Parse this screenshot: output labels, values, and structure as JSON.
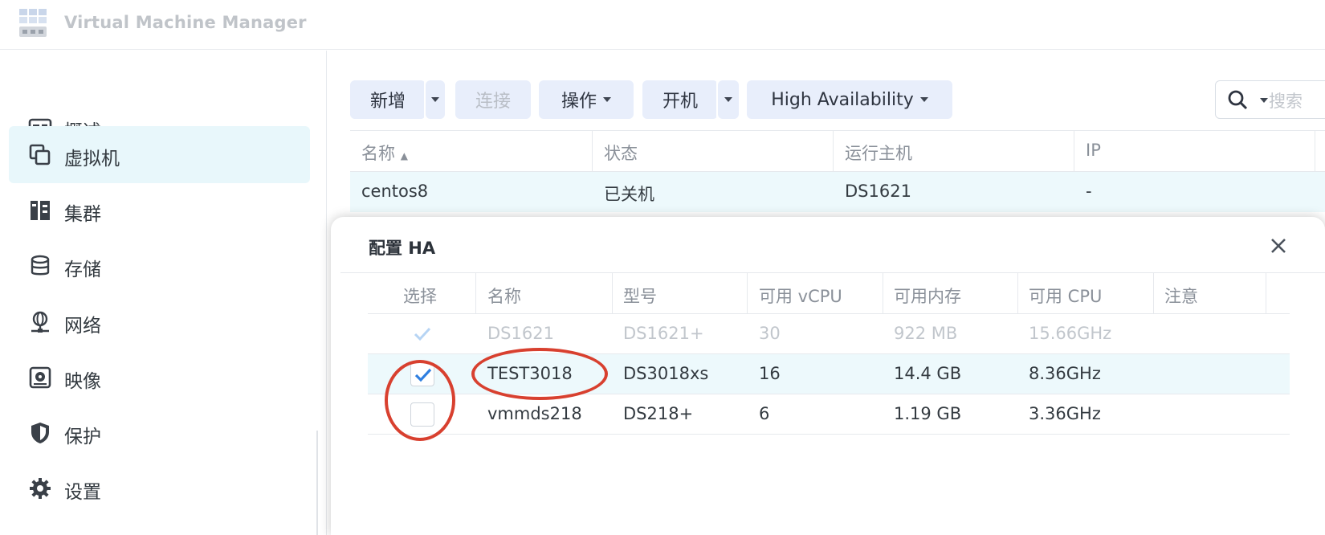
{
  "app": {
    "title": "Virtual Machine Manager"
  },
  "sidebar": {
    "items": [
      {
        "label": "概述",
        "icon": "overview-icon"
      },
      {
        "label": "虚拟机",
        "icon": "virtual-machine-icon",
        "active": true
      },
      {
        "label": "集群",
        "icon": "cluster-icon"
      },
      {
        "label": "存储",
        "icon": "storage-icon"
      },
      {
        "label": "网络",
        "icon": "network-icon"
      },
      {
        "label": "映像",
        "icon": "image-icon"
      },
      {
        "label": "保护",
        "icon": "shield-icon"
      },
      {
        "label": "设置",
        "icon": "gear-icon"
      }
    ]
  },
  "toolbar": {
    "add": "新增",
    "connect": "连接",
    "action": "操作",
    "power_on": "开机",
    "ha": "High Availability",
    "search_placeholder": "搜索"
  },
  "grid": {
    "columns": [
      "名称",
      "状态",
      "运行主机",
      "IP"
    ],
    "rows": [
      {
        "name": "centos8",
        "status": "已关机",
        "host": "DS1621",
        "ip": "-"
      }
    ]
  },
  "dialog": {
    "title": "配置 HA",
    "columns": [
      "选择",
      "名称",
      "型号",
      "可用 vCPU",
      "可用内存",
      "可用 CPU",
      "注意"
    ],
    "rows": [
      {
        "selected": true,
        "disabled": true,
        "name": "DS1621",
        "model": "DS1621+",
        "vcpu": "30",
        "memory": "922 MB",
        "cpu": "15.66GHz",
        "note": ""
      },
      {
        "selected": true,
        "disabled": false,
        "name": "TEST3018",
        "model": "DS3018xs",
        "vcpu": "16",
        "memory": "14.4 GB",
        "cpu": "8.36GHz",
        "note": ""
      },
      {
        "selected": false,
        "disabled": false,
        "name": "vmmds218",
        "model": "DS218+",
        "vcpu": "6",
        "memory": "1.19 GB",
        "cpu": "3.36GHz",
        "note": ""
      }
    ]
  },
  "colors": {
    "accent": "#2f7fe0",
    "annotation": "#d8402f",
    "selected_row": "#edf9fc",
    "button_bg": "#e8eefb"
  }
}
